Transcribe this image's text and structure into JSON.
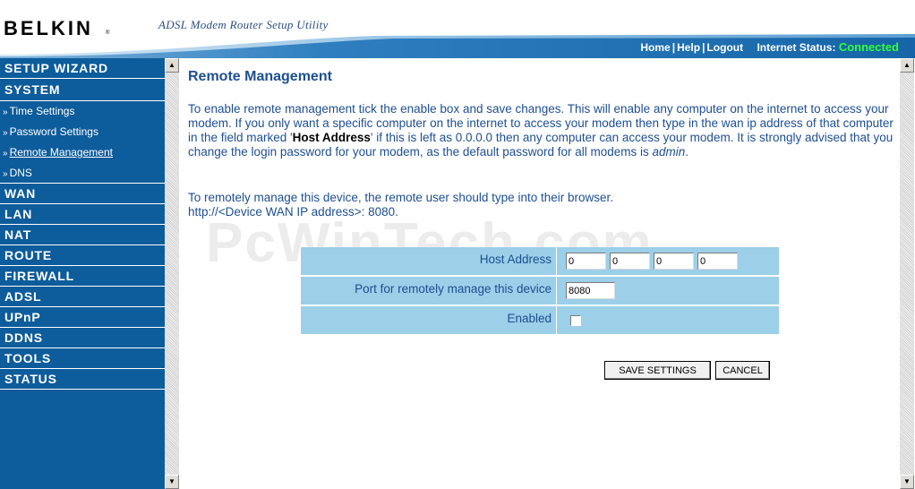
{
  "header": {
    "logo": "BELKIN",
    "registered": "®",
    "utility_title": "ADSL Modem Router Setup Utility",
    "links": {
      "home": "Home",
      "help": "Help",
      "logout": "Logout",
      "separator": "|"
    },
    "status_label": "Internet Status:",
    "status_value": "Connected"
  },
  "colors": {
    "sidebar": "#0d5c9b",
    "header_bar": "#1a6fb0",
    "title_text": "#1d4f91",
    "form_row": "#9ccfe8",
    "connected": "#33ff33"
  },
  "sidebar": {
    "setup_wizard": "SETUP WIZARD",
    "system": "SYSTEM",
    "system_items": [
      {
        "label": "Time Settings"
      },
      {
        "label": "Password Settings"
      },
      {
        "label": "Remote Management"
      },
      {
        "label": "DNS"
      }
    ],
    "arrow": "»",
    "sections": [
      "WAN",
      "LAN",
      "NAT",
      "ROUTE",
      "FIREWALL",
      "ADSL",
      "UPnP",
      "DDNS",
      "TOOLS",
      "STATUS"
    ]
  },
  "main": {
    "title": "Remote Management",
    "intro_1": "To enable remote management tick the enable box and save changes. This will enable any computer on the internet to access your modem. If you only want a specific computer on the internet to access your modem then type in the wan ip address of that computer in the field marked '",
    "intro_bold": "Host Address",
    "intro_2": "' if this is left as 0.0.0.0 then any computer can access your modem. It is strongly advised that you change the login password for your modem, as the default password for all modems is ",
    "intro_italic": "admin",
    "intro_3": ".",
    "remote_line_1": "To remotely manage this device, the remote user should type into their browser.",
    "remote_line_2": "http://<Device WAN IP address>: 8080.",
    "watermark": "PcWinTech.com"
  },
  "form": {
    "host_label": "Host Address",
    "host_octets": [
      "0",
      "0",
      "0",
      "0"
    ],
    "port_label": "Port for remotely manage this device",
    "port_value": "8080",
    "enabled_label": "Enabled",
    "enabled": false
  },
  "buttons": {
    "save": "SAVE SETTINGS",
    "cancel": "CANCEL"
  },
  "scroll": {
    "up_glyph": "▲",
    "down_glyph": "▼"
  }
}
